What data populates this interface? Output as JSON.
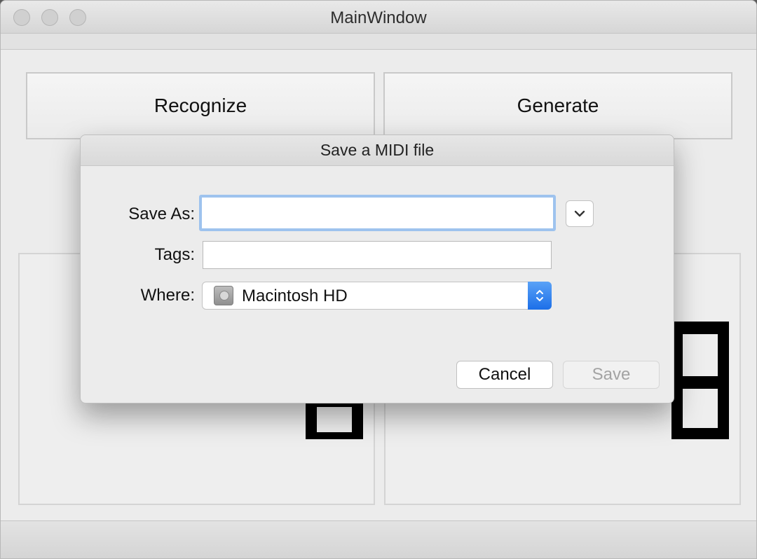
{
  "window": {
    "title": "MainWindow"
  },
  "main": {
    "recognize_label": "Recognize",
    "generate_label": "Generate"
  },
  "dialog": {
    "title": "Save a MIDI file",
    "save_as": {
      "label": "Save As:",
      "value": "",
      "placeholder": ""
    },
    "tags": {
      "label": "Tags:",
      "value": "",
      "placeholder": ""
    },
    "where": {
      "label": "Where:",
      "value": "Macintosh HD",
      "icon": "hard-drive-icon"
    },
    "cancel_label": "Cancel",
    "save_label": "Save"
  },
  "colors": {
    "focus_ring": "#9ec3ee",
    "popup_accent": "#1c6fe8",
    "disabled_text": "#a3a3a3"
  }
}
